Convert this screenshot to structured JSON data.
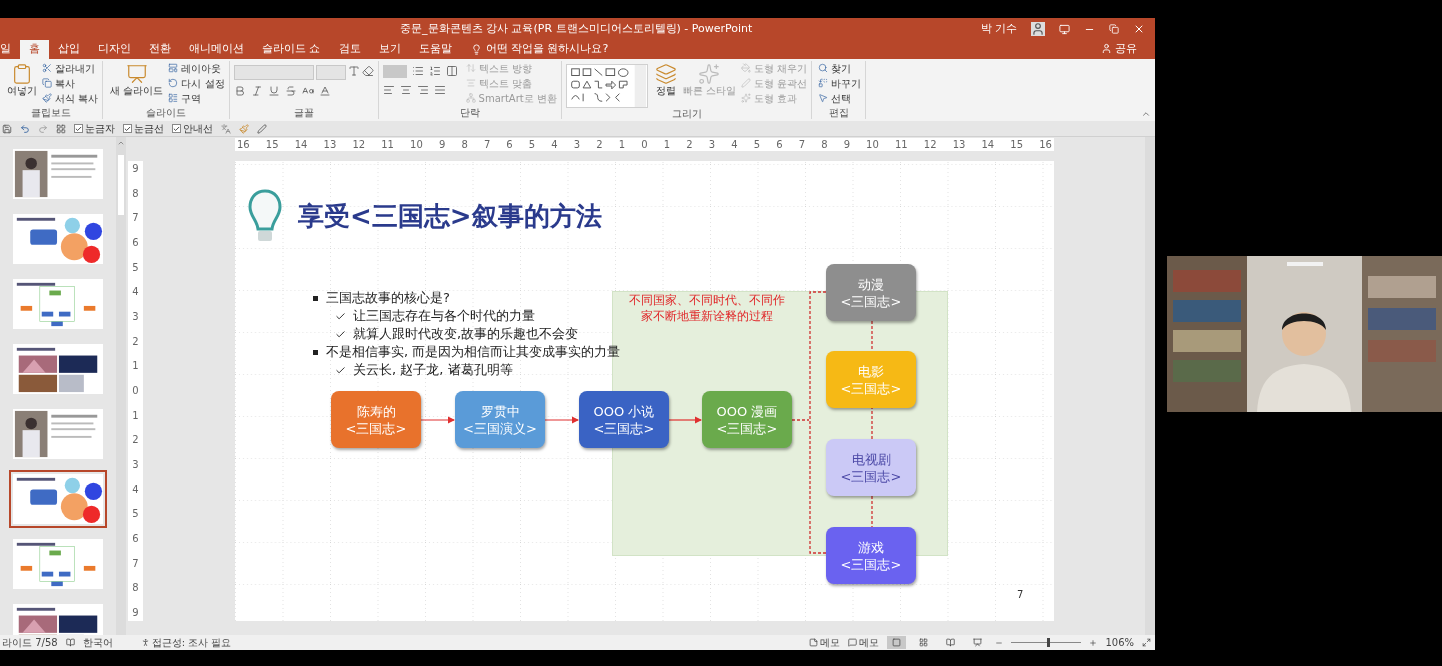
{
  "window": {
    "title": "중문_문화콘텐츠 강사 교육(PR 트랜스미디어스토리텔링) - PowerPoint",
    "user": "박 기수"
  },
  "tabs": [
    {
      "label": "일",
      "selected": false
    },
    {
      "label": "홈",
      "selected": true
    },
    {
      "label": "삽입",
      "selected": false
    },
    {
      "label": "디자인",
      "selected": false
    },
    {
      "label": "전환",
      "selected": false
    },
    {
      "label": "애니메이션",
      "selected": false
    },
    {
      "label": "슬라이드 쇼",
      "selected": false
    },
    {
      "label": "검토",
      "selected": false
    },
    {
      "label": "보기",
      "selected": false
    },
    {
      "label": "도움말",
      "selected": false
    }
  ],
  "tell_me": {
    "placeholder": "어떤 작업을 원하시나요?"
  },
  "share": "공유",
  "ribbon": [
    {
      "kind": "clipboard",
      "label": "클립보드",
      "items": [
        {
          "kind": "large",
          "label": "여넣기",
          "disabled": false
        },
        {
          "kind": "small",
          "label": "잘라내기",
          "disabled": false
        },
        {
          "kind": "small",
          "label": "복사",
          "disabled": false
        },
        {
          "kind": "small",
          "label": "서식 복사",
          "disabled": false
        }
      ]
    },
    {
      "kind": "slides",
      "label": "슬라이드",
      "items": [
        {
          "kind": "large",
          "label": "새 슬라이드",
          "disabled": false
        },
        {
          "kind": "small",
          "label": "레이아웃",
          "disabled": false
        },
        {
          "kind": "small",
          "label": "다시 설정",
          "disabled": false
        },
        {
          "kind": "small",
          "label": "구역",
          "disabled": false
        }
      ]
    },
    {
      "kind": "font",
      "label": "글꼴"
    },
    {
      "kind": "paragraph",
      "label": "단락",
      "items": [
        {
          "kind": "small",
          "label": "텍스트 방향",
          "disabled": true
        },
        {
          "kind": "small",
          "label": "텍스트 맞춤",
          "disabled": true
        },
        {
          "kind": "small",
          "label": "SmartArt로 변환",
          "disabled": true
        }
      ]
    },
    {
      "kind": "drawing",
      "label": "그리기",
      "items": [
        {
          "kind": "large",
          "label": "정렬",
          "disabled": false
        },
        {
          "kind": "large",
          "label": "빠른 스타일",
          "disabled": true
        },
        {
          "kind": "small",
          "label": "도형 채우기",
          "disabled": true
        },
        {
          "kind": "small",
          "label": "도형 윤곽선",
          "disabled": true
        },
        {
          "kind": "small",
          "label": "도형 효과",
          "disabled": true
        }
      ]
    },
    {
      "kind": "editing",
      "label": "편집",
      "items": [
        {
          "kind": "small",
          "label": "찾기",
          "disabled": false
        },
        {
          "kind": "small",
          "label": "바꾸기",
          "disabled": false
        },
        {
          "kind": "small",
          "label": "선택",
          "disabled": false
        }
      ]
    }
  ],
  "view_options": [
    {
      "label": "눈금자",
      "checked": true
    },
    {
      "label": "눈금선",
      "checked": true
    },
    {
      "label": "안내선",
      "checked": true
    }
  ],
  "thumbnails": [
    {
      "selected": false
    },
    {
      "selected": false
    },
    {
      "selected": false
    },
    {
      "selected": false
    },
    {
      "selected": false
    },
    {
      "selected": true
    },
    {
      "selected": false
    },
    {
      "selected": false
    }
  ],
  "ruler": {
    "horizontal": [
      "16",
      "15",
      "14",
      "13",
      "12",
      "11",
      "10",
      "9",
      "8",
      "7",
      "6",
      "5",
      "4",
      "3",
      "2",
      "1",
      "0",
      "1",
      "2",
      "3",
      "4",
      "5",
      "6",
      "7",
      "8",
      "9",
      "10",
      "11",
      "12",
      "13",
      "14",
      "15",
      "16"
    ],
    "vertical": [
      "9",
      "8",
      "7",
      "6",
      "5",
      "4",
      "3",
      "2",
      "1",
      "0",
      "1",
      "2",
      "3",
      "4",
      "5",
      "6",
      "7",
      "8",
      "9"
    ]
  },
  "slide": {
    "title": "享受<三国志>叙事的方法",
    "bullets": [
      {
        "text": "三国志故事的核心是?",
        "children": [
          {
            "text": "让三国志存在与各个时代的力量"
          },
          {
            "text": "就算人跟时代改变,故事的乐趣也不会变"
          }
        ]
      },
      {
        "text": "不是相信事实, 而是因为相信而让其变成事实的力量",
        "children": [
          {
            "text": "关云长, 赵子龙, 诸葛孔明等"
          }
        ]
      }
    ],
    "note": [
      "不同国家、不同时代、不同作",
      "家不断地重新诠释的过程"
    ],
    "flow": [
      {
        "lines": [
          "陈寿的",
          "<三国志>"
        ],
        "color": "#e8722c"
      },
      {
        "lines": [
          "罗贯中",
          "<三国演义>"
        ],
        "color": "#5a9bd8"
      },
      {
        "lines": [
          "OOO 小说",
          "<三国志>"
        ],
        "color": "#3a63c4"
      },
      {
        "lines": [
          "OOO 漫画",
          "<三国志>"
        ],
        "color": "#6aaa4c"
      }
    ],
    "outputs": [
      {
        "lines": [
          "动漫",
          "<三国志>"
        ],
        "color": "#8e8e8e"
      },
      {
        "lines": [
          "电影",
          "<三国志>"
        ],
        "color": "#f6b915"
      },
      {
        "lines": [
          "电视剧",
          "<三国志>"
        ],
        "color": "#cbc9f6"
      },
      {
        "lines": [
          "游戏",
          "<三国志>"
        ],
        "color": "#6a62f0"
      }
    ],
    "page_number": "7"
  },
  "status_bar": {
    "slide": "라이드 7/58",
    "language": "한국어",
    "accessibility": "접근성: 조사 필요",
    "notes": "메모",
    "comments": "메모",
    "views": [
      {
        "selected": true
      },
      {
        "selected": false
      },
      {
        "selected": false
      },
      {
        "selected": false
      }
    ],
    "zoom": {
      "level": 0.52,
      "reading": "106%"
    }
  }
}
